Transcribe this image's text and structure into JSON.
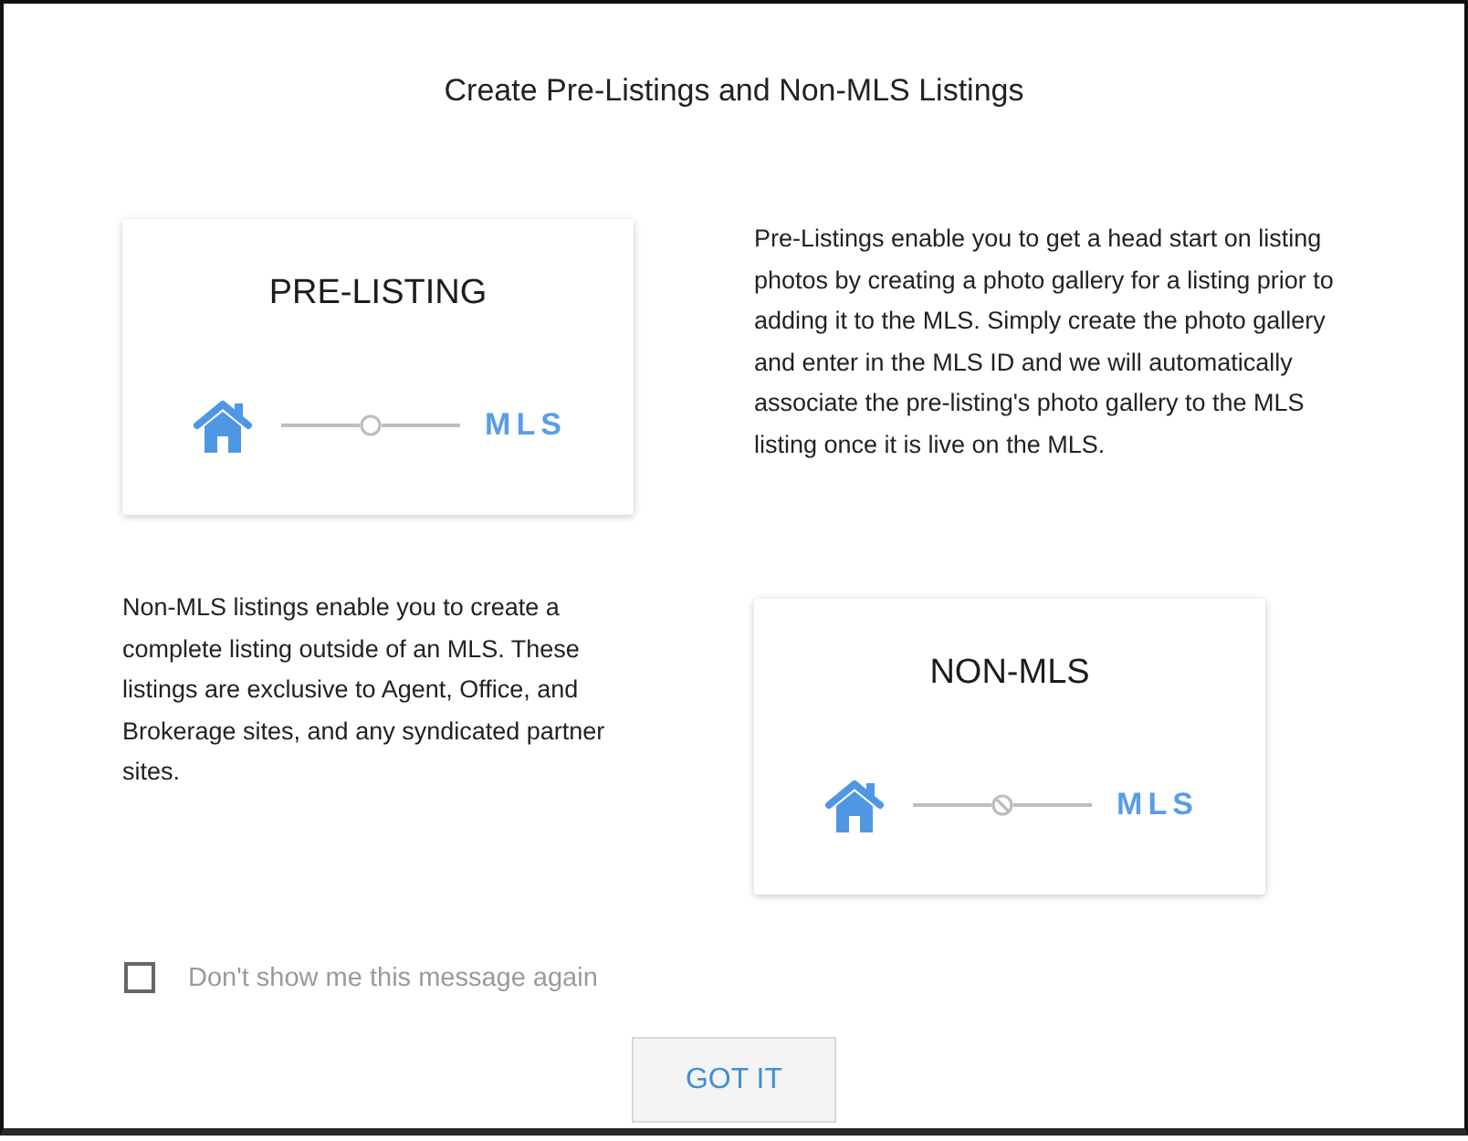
{
  "dialog": {
    "title": "Create Pre-Listings and Non-MLS Listings",
    "sections": [
      {
        "card": {
          "title": "PRE-LISTING",
          "kind": "linked",
          "target": "MLS"
        },
        "description": "Pre-Listings enable you to get a head start on listing photos by creating a photo gallery for a listing prior to adding it to the MLS. Simply create the photo gallery and enter in the MLS ID and we will automatically associate the pre-listing's photo gallery to the MLS listing once it is live on the MLS."
      },
      {
        "card": {
          "title": "NON-MLS",
          "kind": "blocked",
          "target": "MLS"
        },
        "description": "Non-MLS listings enable you to create a complete listing outside of an MLS. These listings are exclusive to Agent, Office, and Brokerage sites, and any syndicated partner sites."
      }
    ],
    "checkbox": {
      "label": "Don't show me this message again",
      "checked": false
    },
    "button": {
      "label": "GOT IT"
    }
  }
}
